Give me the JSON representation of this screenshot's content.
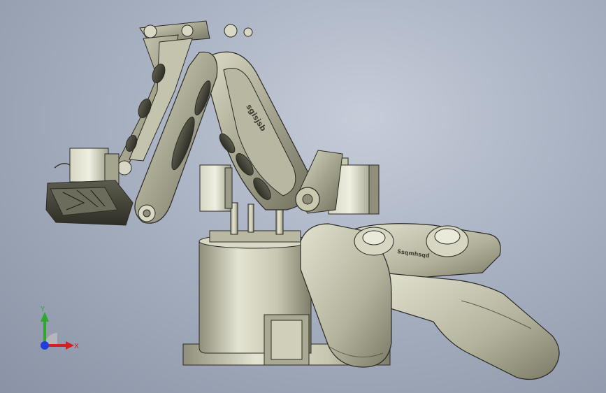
{
  "viewport": {
    "background_top": "#c6cdd9",
    "background_bottom": "#8a93a5"
  },
  "model": {
    "part_color": "#c9c9b0",
    "shadow_color": "#6d6d5c",
    "edge_color": "#2b2b26",
    "arm_engraving": "sgisjsb",
    "controller_engraving": "Ssqmhsqd"
  },
  "triad": {
    "x_label": "X",
    "y_label": "Y",
    "x_color": "#d42020",
    "y_color": "#2fa82f",
    "z_color": "#1f3fd8"
  }
}
